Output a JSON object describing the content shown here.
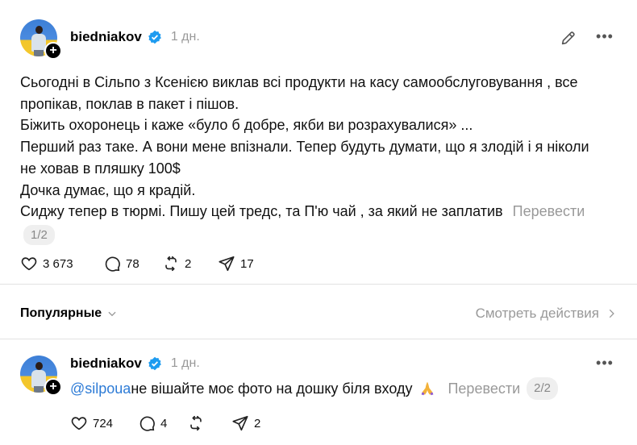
{
  "post": {
    "username": "biedniakov",
    "time": "1 дн.",
    "lines": [
      "Сьогодні в Сільпо з Ксенією виклав всі продукти на касу самообслуговування , все",
      "пропікав, поклав в пакет і пішов.",
      "Біжить охоронець і каже «було б добре, якби ви розрахувалися» ...",
      "Перший раз таке. А вони мене впізнали. Тепер будуть думати, що я злодій і я ніколи",
      "не ховав в пляшку 100$",
      "Дочка думає, що я крадій.",
      "Сиджу тепер в тюрмі. Пишу цей тредс, та П'ю чай , за який не заплатив"
    ],
    "translate_label": "Перевести",
    "page_indicator": "1/2",
    "likes": "3 673",
    "comments": "78",
    "reposts": "2",
    "shares": "17"
  },
  "sort": {
    "label": "Популярные",
    "activity_label": "Смотреть действия"
  },
  "reply": {
    "username": "biedniakov",
    "time": "1 дн.",
    "mention": "@silpoua",
    "text": " не вішайте моє фото на дошку біля входу",
    "translate_label": "Перевести",
    "page_indicator": "2/2",
    "likes": "724",
    "comments": "4",
    "shares": "2"
  },
  "colors": {
    "verified": "#1d9bf0",
    "mention": "#2d7bd6",
    "muted": "#999999"
  },
  "icons": [
    "pencil-icon",
    "more-icon",
    "verified-icon",
    "heart-icon",
    "comment-icon",
    "repost-icon",
    "share-icon",
    "chevron-down-icon",
    "chevron-right-icon",
    "pray-icon"
  ]
}
